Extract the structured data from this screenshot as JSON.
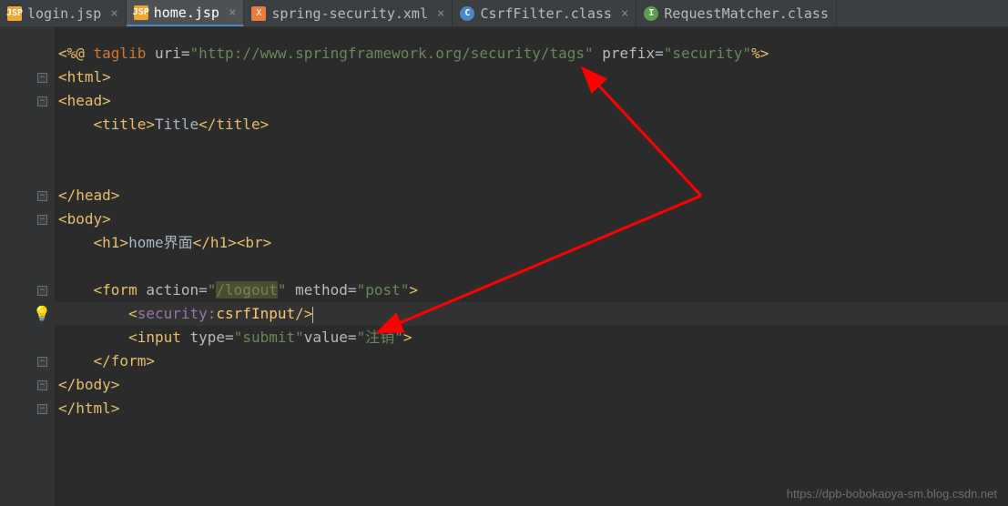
{
  "tabs": [
    {
      "label": "login.jsp",
      "icon": "JSP",
      "iconClass": "icon-jsp",
      "active": false
    },
    {
      "label": "home.jsp",
      "icon": "JSP",
      "iconClass": "icon-jsp",
      "active": true
    },
    {
      "label": "spring-security.xml",
      "icon": "X",
      "iconClass": "icon-xml",
      "active": false
    },
    {
      "label": "CsrfFilter.class",
      "icon": "C",
      "iconClass": "icon-class-c",
      "active": false
    },
    {
      "label": "RequestMatcher.class",
      "icon": "I",
      "iconClass": "icon-class-i",
      "active": false
    }
  ],
  "code": {
    "taglib": {
      "open": "<%@ ",
      "kw1": "taglib ",
      "attr1": "uri",
      "eq": "=",
      "q": "\"",
      "uri": "http://www.springframework.org/security/tags",
      "attr2": " prefix",
      "prefix": "security",
      "close": "%>"
    },
    "html_open": "<html>",
    "head_open": "<head>",
    "title": {
      "open": "<title>",
      "text": "Title",
      "close": "</title>"
    },
    "head_close": "</head>",
    "body_open": "<body>",
    "h1": {
      "open": "<h1>",
      "text": "home界面",
      "close": "</h1>",
      "br": "<br>"
    },
    "form": {
      "open": "<form ",
      "attr1": "action",
      "val1": "/logout",
      "attr2": " method",
      "val2": "post",
      "close": ">"
    },
    "csrf": {
      "open": "<",
      "ns": "security:",
      "fn": "csrfInput",
      "close": "/>"
    },
    "input": {
      "open": "<input ",
      "attr1": "type",
      "val1": "submit",
      "attr2": "value",
      "val2": "注销",
      "close": ">"
    },
    "form_close": "</form>",
    "body_close": "</body>",
    "html_close": "</html>"
  },
  "watermark": "https://dpb-bobokaoya-sm.blog.csdn.net"
}
